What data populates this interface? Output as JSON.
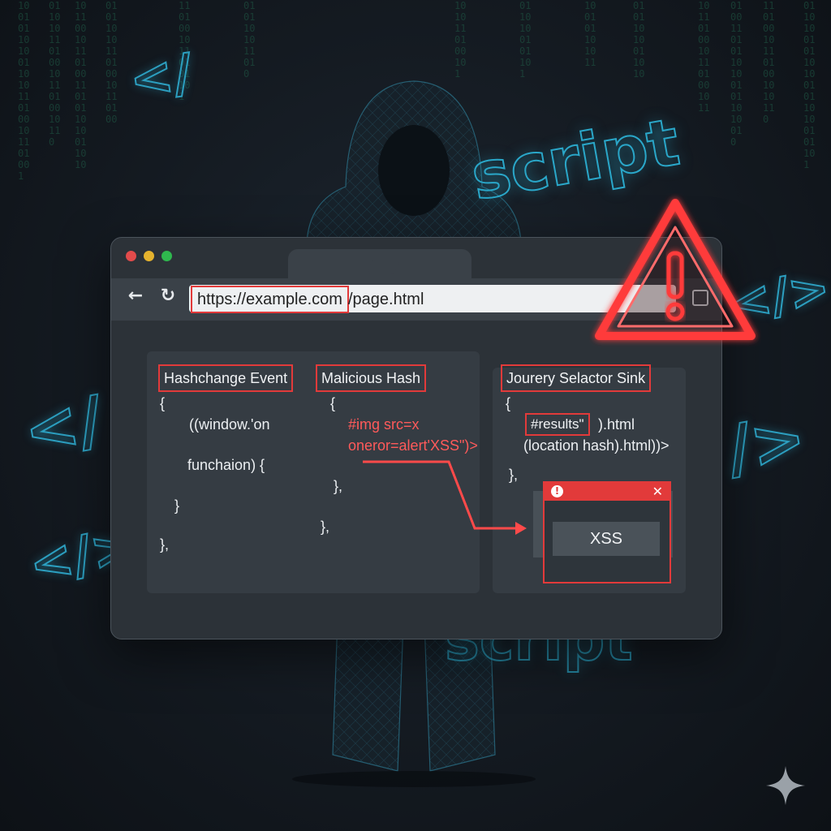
{
  "decor": {
    "word_top": "script",
    "word_bottom": "script",
    "tag_symbols": [
      "</",
      "</",
      "</>",
      "</>",
      "/>"
    ]
  },
  "browser": {
    "url_host": "https://example.com",
    "url_path": "/page.html",
    "panels": {
      "left": {
        "label": "Hashchange Event",
        "lines": [
          "{",
          "((window.'on",
          "funchaion) {",
          "}",
          "},"
        ]
      },
      "middle": {
        "label": "Malicious Hash",
        "lines": [
          "{",
          "},",
          "},"
        ],
        "payload": [
          "#img src=x",
          "oneror=alert'XSS\")>"
        ]
      },
      "right": {
        "label": "Jourery Selactor Sink",
        "lines": [
          "{",
          "(location hash).html))>",
          "},"
        ],
        "selector": "#results\"",
        "after_selector": ").html"
      }
    },
    "popup": {
      "message": "XSS",
      "close_glyph": "✕",
      "alert_glyph": "!"
    }
  },
  "colors": {
    "accent_red": "#e23a3a",
    "accent_cyan": "#2aa7c9"
  }
}
